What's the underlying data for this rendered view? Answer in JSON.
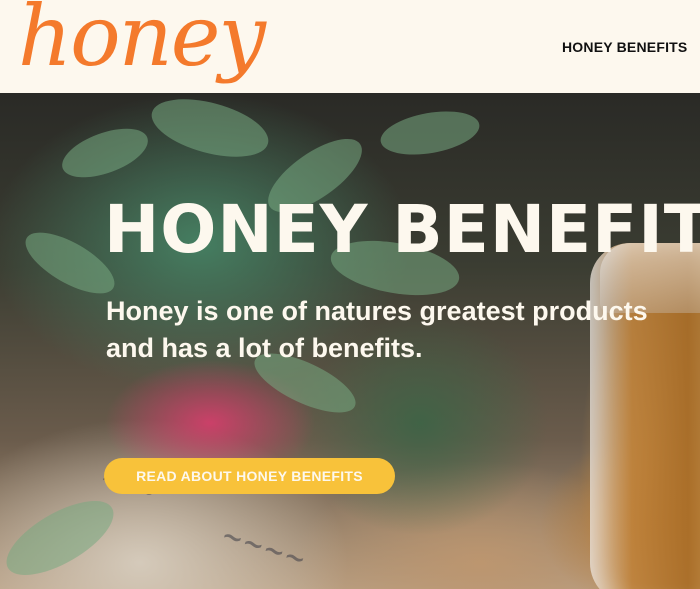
{
  "header": {
    "logo_text": "honey",
    "nav_link": "HONEY BENEFITS"
  },
  "hero": {
    "title": "HONEY BENEFITS",
    "subtitle": "Honey is one of natures greatest products and has a lot of benefits.",
    "cta_label": "READ ABOUT HONEY BENEFITS",
    "background_image": "blurred photo of herbs, pink flower pot and a honey jar"
  },
  "colors": {
    "background": "#fdf8ee",
    "logo": "#f47a2c",
    "cta": "#f8c23a",
    "hero_text": "#fdf8ee"
  }
}
